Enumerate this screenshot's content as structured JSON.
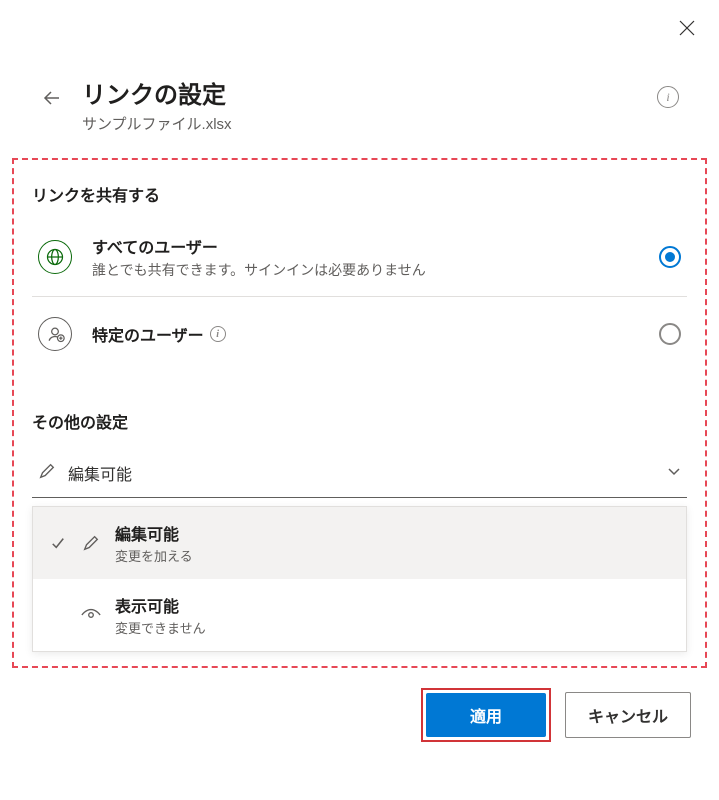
{
  "header": {
    "title": "リンクの設定",
    "subtitle": "サンプルファイル.xlsx"
  },
  "share": {
    "section_title": "リンクを共有する",
    "options": [
      {
        "title": "すべてのユーザー",
        "desc": "誰とでも共有できます。サインインは必要ありません"
      },
      {
        "title": "特定のユーザー"
      }
    ]
  },
  "other": {
    "section_title": "その他の設定",
    "dropdown_label": "編集可能",
    "items": [
      {
        "title": "編集可能",
        "desc": "変更を加える"
      },
      {
        "title": "表示可能",
        "desc": "変更できません"
      }
    ]
  },
  "footer": {
    "apply": "適用",
    "cancel": "キャンセル"
  }
}
